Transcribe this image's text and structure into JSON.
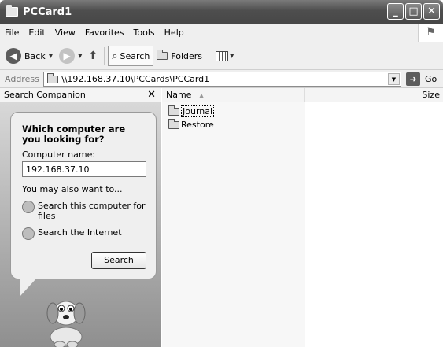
{
  "window": {
    "title": "PCCard1"
  },
  "menu": {
    "items": [
      "File",
      "Edit",
      "View",
      "Favorites",
      "Tools",
      "Help"
    ]
  },
  "toolbar": {
    "back_label": "Back",
    "search_label": "Search",
    "folders_label": "Folders"
  },
  "address": {
    "label": "Address",
    "value": "\\\\192.168.37.10\\PCCards\\PCCard1",
    "go_label": "Go"
  },
  "search_companion": {
    "header": "Search Companion",
    "question": "Which computer are you looking for?",
    "computer_name_label": "Computer name:",
    "computer_name_value": "192.168.37.10",
    "also_label": "You may also want to...",
    "option1": "Search this computer for files",
    "option2": "Search the Internet",
    "search_button": "Search"
  },
  "file_list": {
    "columns": {
      "name": "Name",
      "size": "Size"
    },
    "items": [
      "Journal",
      "Restore"
    ]
  },
  "icons": {
    "window": "folder-icon",
    "back": "back-arrow-icon",
    "forward": "forward-arrow-icon",
    "up": "up-folder-icon",
    "search": "magnifier-icon",
    "folders": "folders-icon",
    "views": "views-icon",
    "go": "go-arrow-icon",
    "close": "close-icon"
  }
}
